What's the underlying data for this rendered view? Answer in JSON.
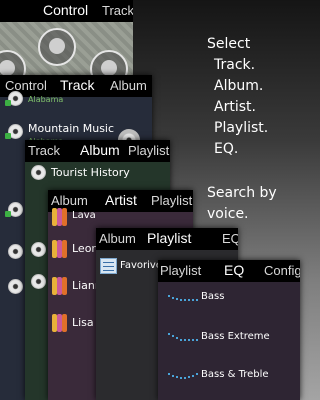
{
  "layers": {
    "control": {
      "tabs": [
        "Control",
        "Track"
      ]
    },
    "track": {
      "tabs": [
        "Control",
        "Track",
        "Album"
      ],
      "partial_line": "Alabama",
      "item_title": "Mountain Music",
      "item_sub": "Alabama"
    },
    "album": {
      "tabs": [
        "Track",
        "Album",
        "Playlist"
      ],
      "item": "Tourist History"
    },
    "artist": {
      "tabs": [
        "Album",
        "Artist",
        "Playlist"
      ],
      "items": [
        "Lava",
        "Leona",
        "Lianne",
        "Lisa L"
      ]
    },
    "playlist": {
      "tabs": [
        "Album",
        "Playlist",
        "EQ"
      ],
      "item": "Favorive"
    },
    "eq": {
      "tabs": [
        "Playlist",
        "EQ",
        "Config"
      ],
      "items": [
        "Bass",
        "Bass Extreme",
        "Bass & Treble"
      ]
    }
  },
  "description": {
    "lines": [
      "Select",
      "Track.",
      "Album.",
      "Artist.",
      "Playlist.",
      "EQ."
    ],
    "voice": "Search by voice."
  },
  "colors": {
    "tab_bar": "#000000",
    "cd_badge": "#3cb043",
    "eq_curve": "#4aa3d8"
  }
}
